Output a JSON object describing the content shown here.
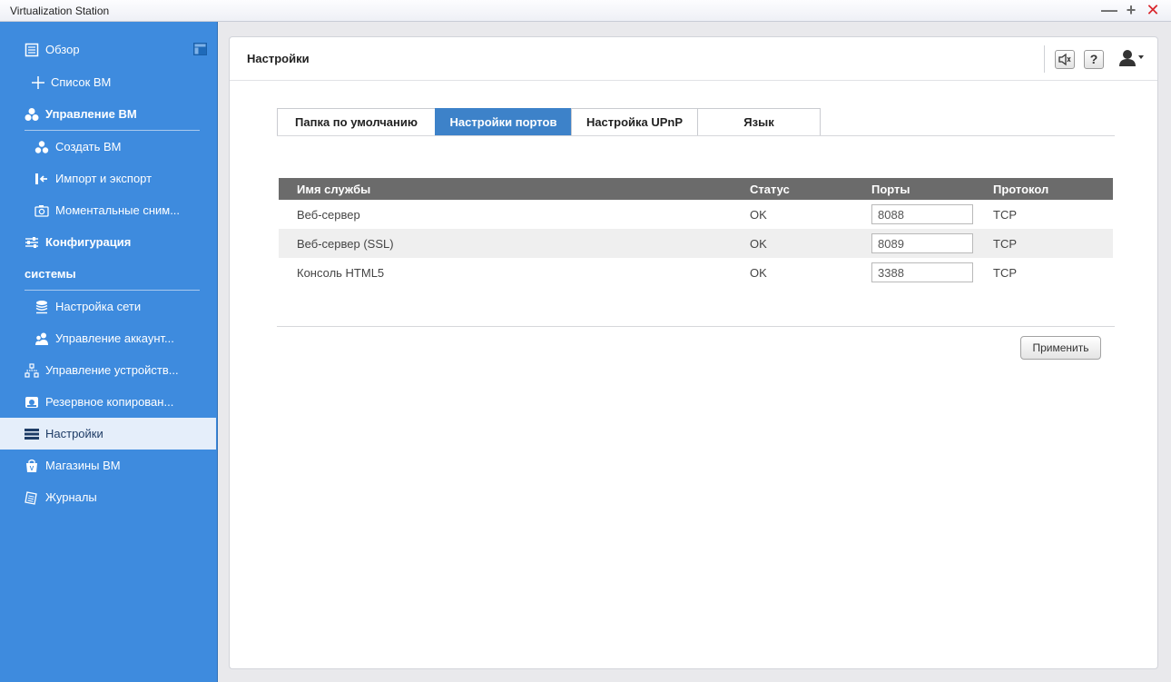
{
  "window": {
    "title": "Virtualization Station",
    "min_glyph": "—",
    "max_glyph": "+",
    "close_glyph": "✕"
  },
  "sidebar": {
    "items": [
      {
        "label": "Обзор",
        "icon": "overview-icon"
      },
      {
        "label": "Список ВМ",
        "icon": "plus-icon"
      },
      {
        "label": "Управление ВМ",
        "icon": "vm-management-icon"
      },
      {
        "label": "Создать ВМ",
        "icon": "create-vm-icon"
      },
      {
        "label": "Импорт и экспорт",
        "icon": "import-export-icon"
      },
      {
        "label": "Моментальные сним...",
        "icon": "camera-icon"
      },
      {
        "label": "Конфигурация",
        "icon": "sliders-icon"
      },
      {
        "label": "системы"
      },
      {
        "label": "Настройка сети",
        "icon": "network-icon"
      },
      {
        "label": "Управление аккаунт...",
        "icon": "users-icon"
      },
      {
        "label": "Управление устройств...",
        "icon": "devices-icon"
      },
      {
        "label": "Резервное копирован...",
        "icon": "backup-icon"
      },
      {
        "label": "Настройки",
        "icon": "settings-icon"
      },
      {
        "label": "Магазины ВМ",
        "icon": "store-icon"
      },
      {
        "label": "Журналы",
        "icon": "logs-icon"
      }
    ],
    "active_index": 12
  },
  "main": {
    "title": "Настройки",
    "help_glyph": "?",
    "tabs": [
      {
        "label": "Папка по умолчанию"
      },
      {
        "label": "Настройки портов"
      },
      {
        "label": "Настройка UPnP"
      },
      {
        "label": "Язык"
      }
    ],
    "active_tab": 1,
    "table": {
      "headers": [
        "Имя службы",
        "Статус",
        "Порты",
        "Протокол"
      ],
      "rows": [
        {
          "service": "Веб-сервер",
          "status": "OK",
          "port": "8088",
          "protocol": "TCP"
        },
        {
          "service": "Веб-сервер (SSL)",
          "status": "OK",
          "port": "8089",
          "protocol": "TCP"
        },
        {
          "service": "Консоль HTML5",
          "status": "OK",
          "port": "3388",
          "protocol": "TCP"
        }
      ]
    },
    "apply_label": "Применить"
  },
  "colors": {
    "sidebar_bg": "#3e8bde",
    "active_tab": "#3d82c9",
    "table_header": "#6b6b6b",
    "close_red": "#d9262c"
  }
}
